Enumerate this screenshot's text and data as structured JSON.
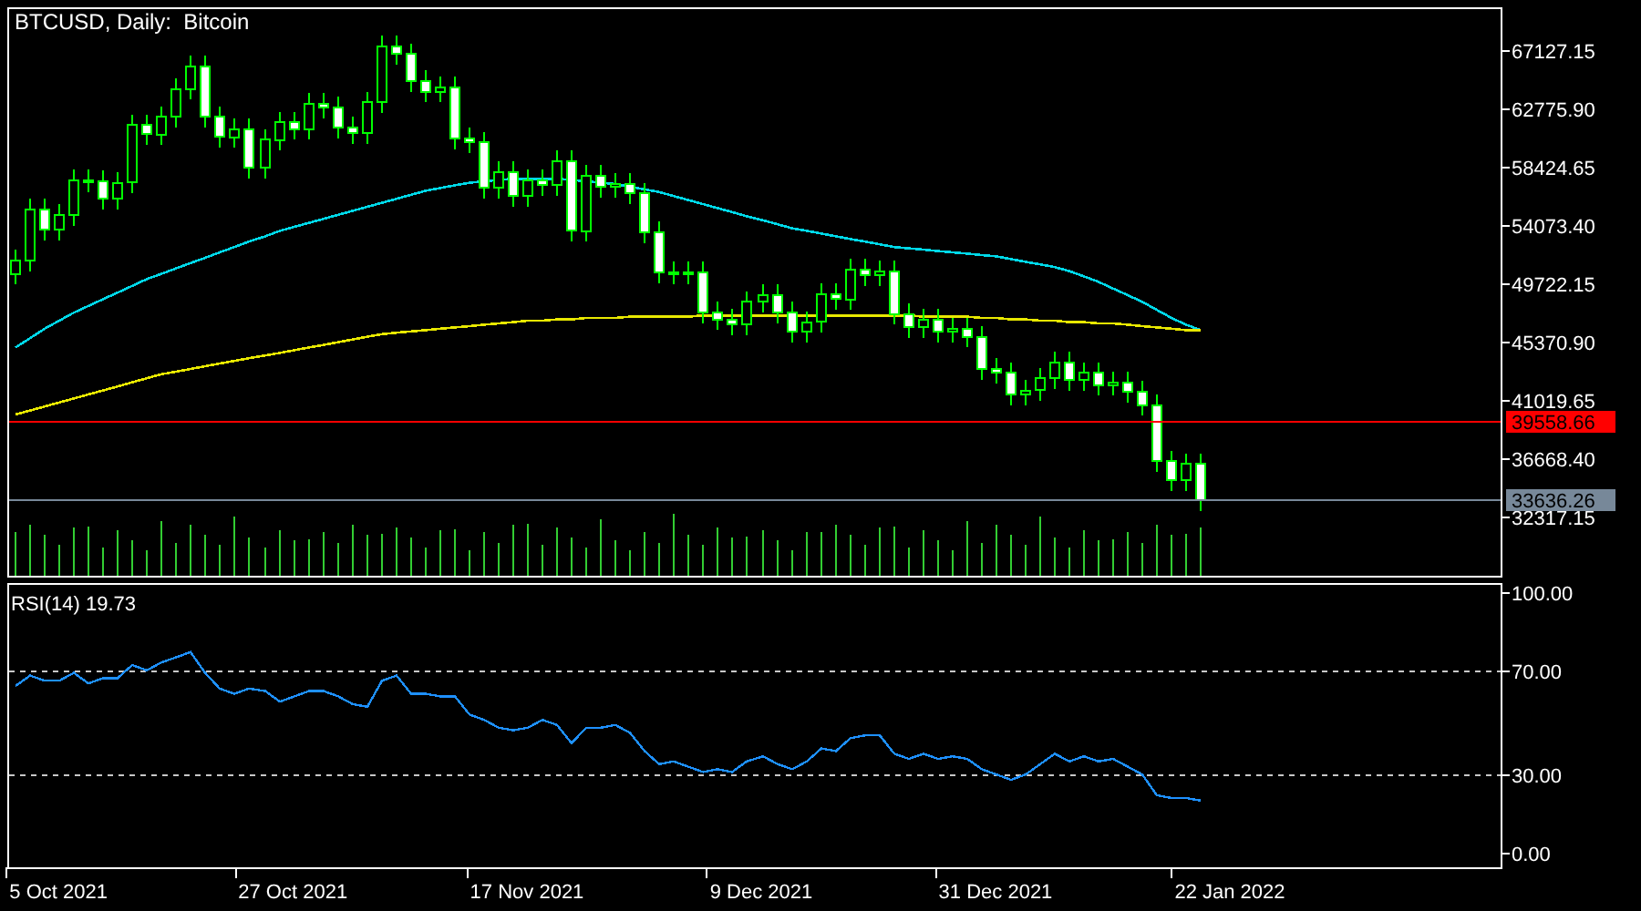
{
  "price_chart": {
    "chart_data": {
      "type": "candlestick",
      "title": "BTCUSD, Daily:  Bitcoin",
      "ylim": [
        27964.9,
        70390.7
      ],
      "yticks": [
        {
          "value": 67127.15,
          "label": "67127.15"
        },
        {
          "value": 62775.9,
          "label": "62775.90"
        },
        {
          "value": 58424.65,
          "label": "58424.65"
        },
        {
          "value": 54073.4,
          "label": "54073.40"
        },
        {
          "value": 49722.15,
          "label": "49722.15"
        },
        {
          "value": 45370.9,
          "label": "45370.90"
        },
        {
          "value": 41019.65,
          "label": "41019.65"
        },
        {
          "value": 36668.4,
          "label": "36668.40"
        },
        {
          "value": 32317.15,
          "label": "32317.15"
        }
      ],
      "categories": [
        null,
        null,
        null,
        null,
        null,
        null,
        null,
        null,
        null,
        null,
        null,
        null,
        null,
        null,
        null,
        null,
        null,
        null,
        null,
        null,
        null,
        null,
        null,
        null,
        null,
        null,
        null,
        null,
        null,
        null,
        null,
        null,
        null,
        null,
        null,
        null,
        null,
        null,
        null,
        null,
        null,
        null,
        null,
        null,
        null,
        null,
        null,
        null,
        null,
        null,
        null,
        null,
        null,
        null,
        null,
        null,
        null,
        null,
        null,
        null,
        null,
        null,
        null,
        null,
        null,
        null,
        null,
        null,
        null,
        null,
        null,
        null,
        null,
        null,
        null,
        null,
        null,
        null,
        null,
        null,
        null,
        null,
        null,
        null,
        null,
        null,
        null,
        null,
        null,
        null,
        null,
        null,
        null,
        null,
        null,
        null,
        null,
        null,
        null,
        null,
        null,
        null
      ],
      "ohlc": [
        [
          50500,
          52300,
          49700,
          51500
        ],
        [
          51500,
          56100,
          50700,
          55300
        ],
        [
          55300,
          56100,
          53000,
          53800
        ],
        [
          53800,
          55700,
          53000,
          54900
        ],
        [
          54900,
          58300,
          54100,
          57500
        ],
        [
          57500,
          58300,
          56600,
          57400
        ],
        [
          57400,
          58200,
          55300,
          56100
        ],
        [
          56100,
          58100,
          55300,
          57300
        ],
        [
          57300,
          62400,
          56500,
          61600
        ],
        [
          61600,
          62400,
          60100,
          60900
        ],
        [
          60900,
          63000,
          60100,
          62200
        ],
        [
          62200,
          65100,
          61400,
          64300
        ],
        [
          64300,
          66800,
          63500,
          66000
        ],
        [
          66000,
          66800,
          61400,
          62200
        ],
        [
          62200,
          63000,
          59900,
          60700
        ],
        [
          60700,
          62100,
          59900,
          61300
        ],
        [
          61300,
          62100,
          57600,
          58400
        ],
        [
          58400,
          61300,
          57600,
          60500
        ],
        [
          60500,
          62600,
          59700,
          61800
        ],
        [
          61800,
          62600,
          60500,
          61300
        ],
        [
          61300,
          64000,
          60500,
          63200
        ],
        [
          63200,
          64000,
          62100,
          62900
        ],
        [
          62900,
          63700,
          60600,
          61400
        ],
        [
          61400,
          62200,
          60200,
          61000
        ],
        [
          61000,
          64100,
          60200,
          63300
        ],
        [
          63300,
          68300,
          62500,
          67500
        ],
        [
          67500,
          68300,
          66100,
          66900
        ],
        [
          66900,
          67700,
          64100,
          64900
        ],
        [
          64900,
          65700,
          63300,
          64100
        ],
        [
          64100,
          65200,
          63300,
          64400
        ],
        [
          64400,
          65200,
          59800,
          60600
        ],
        [
          60600,
          61400,
          59500,
          60300
        ],
        [
          60300,
          61100,
          56100,
          56900
        ],
        [
          56900,
          58900,
          56100,
          58100
        ],
        [
          58100,
          58900,
          55500,
          56300
        ],
        [
          56300,
          58300,
          55500,
          57500
        ],
        [
          57500,
          58300,
          56300,
          57100
        ],
        [
          57100,
          59700,
          56300,
          58900
        ],
        [
          58900,
          59700,
          52900,
          53700
        ],
        [
          53700,
          58600,
          52900,
          57800
        ],
        [
          57800,
          58600,
          56200,
          57000
        ],
        [
          57000,
          58000,
          56200,
          57200
        ],
        [
          57200,
          58000,
          55700,
          56500
        ],
        [
          56500,
          57300,
          52800,
          53600
        ],
        [
          53600,
          54400,
          49800,
          50600
        ],
        [
          50600,
          51400,
          49700,
          50500
        ],
        [
          50500,
          51400,
          49700,
          50600
        ],
        [
          50600,
          51400,
          46800,
          47600
        ],
        [
          47600,
          48400,
          46300,
          47100
        ],
        [
          47100,
          47900,
          45900,
          46700
        ],
        [
          46700,
          49200,
          45900,
          48400
        ],
        [
          48400,
          49700,
          47600,
          48900
        ],
        [
          48900,
          49700,
          46800,
          47600
        ],
        [
          47600,
          48400,
          45400,
          46200
        ],
        [
          46200,
          47700,
          45400,
          46900
        ],
        [
          46900,
          49800,
          46100,
          49000
        ],
        [
          49000,
          49800,
          47800,
          48600
        ],
        [
          48600,
          51600,
          47800,
          50800
        ],
        [
          50800,
          51600,
          49600,
          50400
        ],
        [
          50400,
          51500,
          49600,
          50700
        ],
        [
          50700,
          51500,
          46700,
          47500
        ],
        [
          47500,
          48300,
          45700,
          46500
        ],
        [
          46500,
          47900,
          45700,
          47100
        ],
        [
          47100,
          47900,
          45400,
          46200
        ],
        [
          46200,
          47200,
          45400,
          46400
        ],
        [
          46400,
          47200,
          45000,
          45800
        ],
        [
          45800,
          46600,
          42600,
          43400
        ],
        [
          43400,
          44200,
          42300,
          43100
        ],
        [
          43100,
          43900,
          40700,
          41500
        ],
        [
          41500,
          42600,
          40700,
          41800
        ],
        [
          41800,
          43500,
          41000,
          42700
        ],
        [
          42700,
          44700,
          41900,
          43900
        ],
        [
          43900,
          44700,
          41800,
          42600
        ],
        [
          42600,
          43900,
          41800,
          43100
        ],
        [
          43100,
          43900,
          41400,
          42200
        ],
        [
          42200,
          43200,
          41400,
          42400
        ],
        [
          42400,
          43200,
          40900,
          41700
        ],
        [
          41700,
          42500,
          39900,
          40700
        ],
        [
          40700,
          41500,
          35700,
          36500
        ],
        [
          36500,
          37300,
          34300,
          35100
        ],
        [
          35100,
          37100,
          34300,
          36300
        ],
        [
          36300,
          37100,
          32800,
          33600
        ],
        null,
        null,
        null,
        null,
        null,
        null,
        null,
        null,
        null,
        null,
        null,
        null,
        null,
        null,
        null,
        null,
        null,
        null,
        null,
        null
      ],
      "series": [
        {
          "type": "line",
          "color": "#00d8e8",
          "values": [
            45000,
            45700,
            46400,
            47000,
            47600,
            48100,
            48600,
            49100,
            49600,
            50100,
            50500,
            50900,
            51300,
            51700,
            52100,
            52500,
            52900,
            53300,
            53700,
            54000,
            54300,
            54600,
            54900,
            55200,
            55500,
            55800,
            56100,
            56400,
            56700,
            56900,
            57100,
            57300,
            57400,
            57500,
            57600,
            57600,
            57600,
            57600,
            57500,
            57400,
            57300,
            57200,
            57000,
            56800,
            56600,
            56300,
            56000,
            55700,
            55400,
            55100,
            54800,
            54500,
            54200,
            53900,
            53700,
            53500,
            53300,
            53100,
            52900,
            52700,
            52500,
            52400,
            52300,
            52200,
            52100,
            52000,
            51900,
            51800,
            51600,
            51400,
            51200,
            51000,
            50700,
            50300,
            49900,
            49400,
            48900,
            48400,
            47800,
            47200,
            46700,
            46300,
            null,
            null,
            null,
            null,
            null,
            null,
            null,
            null,
            null,
            null,
            null,
            null,
            null,
            null,
            null,
            null,
            null,
            null,
            null,
            null
          ]
        },
        {
          "type": "line",
          "color": "#e8e800",
          "values": [
            40000,
            40300,
            40600,
            40900,
            41200,
            41500,
            41800,
            42100,
            42400,
            42700,
            43000,
            43200,
            43400,
            43600,
            43800,
            44000,
            44200,
            44400,
            44600,
            44800,
            45000,
            45200,
            45400,
            45600,
            45800,
            46000,
            46100,
            46200,
            46300,
            46400,
            46500,
            46600,
            46700,
            46800,
            46900,
            47000,
            47000,
            47100,
            47100,
            47200,
            47200,
            47200,
            47300,
            47300,
            47300,
            47300,
            47300,
            47400,
            47400,
            47400,
            47400,
            47400,
            47400,
            47400,
            47400,
            47400,
            47400,
            47400,
            47400,
            47400,
            47400,
            47400,
            47300,
            47300,
            47300,
            47300,
            47200,
            47200,
            47100,
            47100,
            47000,
            47000,
            46900,
            46900,
            46800,
            46800,
            46700,
            46600,
            46500,
            46400,
            46300,
            46300,
            null,
            null,
            null,
            null,
            null,
            null,
            null,
            null,
            null,
            null,
            null,
            null,
            null,
            null,
            null,
            null,
            null,
            null,
            null,
            null
          ]
        }
      ],
      "ref_lines": [
        {
          "axis": "y",
          "value": 39558.66,
          "label": "39558.66",
          "color": "#ff0000"
        },
        {
          "axis": "y",
          "value": 33636.26,
          "label": "33636.26",
          "color": "#778899"
        }
      ]
    }
  },
  "rsi_chart": {
    "chart_data": {
      "type": "line",
      "title": "RSI(14) 19.73",
      "ylim": [
        -5.6,
        103.5
      ],
      "yticks": [
        {
          "value": 100,
          "label": "100.00"
        },
        {
          "value": 70,
          "label": "70.00"
        },
        {
          "value": 30,
          "label": "30.00"
        },
        {
          "value": 0,
          "label": "0.00"
        }
      ],
      "categories": [
        null,
        null,
        null,
        "5 Oct 2021",
        null,
        null,
        null,
        null,
        null,
        null,
        null,
        null,
        null,
        null,
        null,
        null,
        null,
        null,
        null,
        "27 Oct 2021",
        null,
        null,
        null,
        null,
        null,
        null,
        null,
        null,
        null,
        null,
        null,
        null,
        null,
        null,
        null,
        "17 Nov 2021",
        null,
        null,
        null,
        null,
        null,
        null,
        null,
        null,
        null,
        null,
        null,
        null,
        null,
        null,
        null,
        "9 Dec 2021",
        null,
        null,
        null,
        null,
        null,
        null,
        null,
        null,
        null,
        null,
        null,
        null,
        null,
        null,
        null,
        "31 Dec 2021",
        null,
        null,
        null,
        null,
        null,
        null,
        null,
        null,
        null,
        null,
        null,
        null,
        null,
        null,
        null,
        "22 Jan 2022",
        null,
        null,
        null,
        null,
        null,
        null,
        null,
        null,
        null,
        null,
        null,
        null,
        null,
        null,
        null,
        null,
        null,
        null
      ],
      "series": [
        {
          "color": "#1e90ff",
          "values": [
            64,
            68,
            66,
            66,
            69,
            65,
            67,
            67,
            72,
            70,
            73,
            75,
            77,
            69,
            63,
            61,
            63,
            62,
            58,
            60,
            62,
            62,
            60,
            57,
            56,
            66,
            68,
            61,
            61,
            60,
            60,
            53,
            51,
            48,
            47,
            48,
            51,
            49,
            42,
            48,
            48,
            49,
            46,
            39,
            34,
            35,
            33,
            31,
            32,
            31,
            35,
            37,
            34,
            32,
            35,
            40,
            39,
            44,
            45,
            45,
            38,
            36,
            38,
            36,
            37,
            36,
            32,
            30,
            28,
            30,
            34,
            38,
            35,
            37,
            35,
            36,
            33,
            30,
            22,
            21,
            21,
            20,
            null,
            null,
            null,
            null,
            null,
            null,
            null,
            null,
            null,
            null,
            null,
            null,
            null,
            null,
            null,
            null,
            null,
            null,
            null,
            null
          ]
        }
      ],
      "ref_lines": [
        {
          "axis": "y",
          "value": 70
        },
        {
          "axis": "y",
          "value": 30
        }
      ]
    }
  }
}
